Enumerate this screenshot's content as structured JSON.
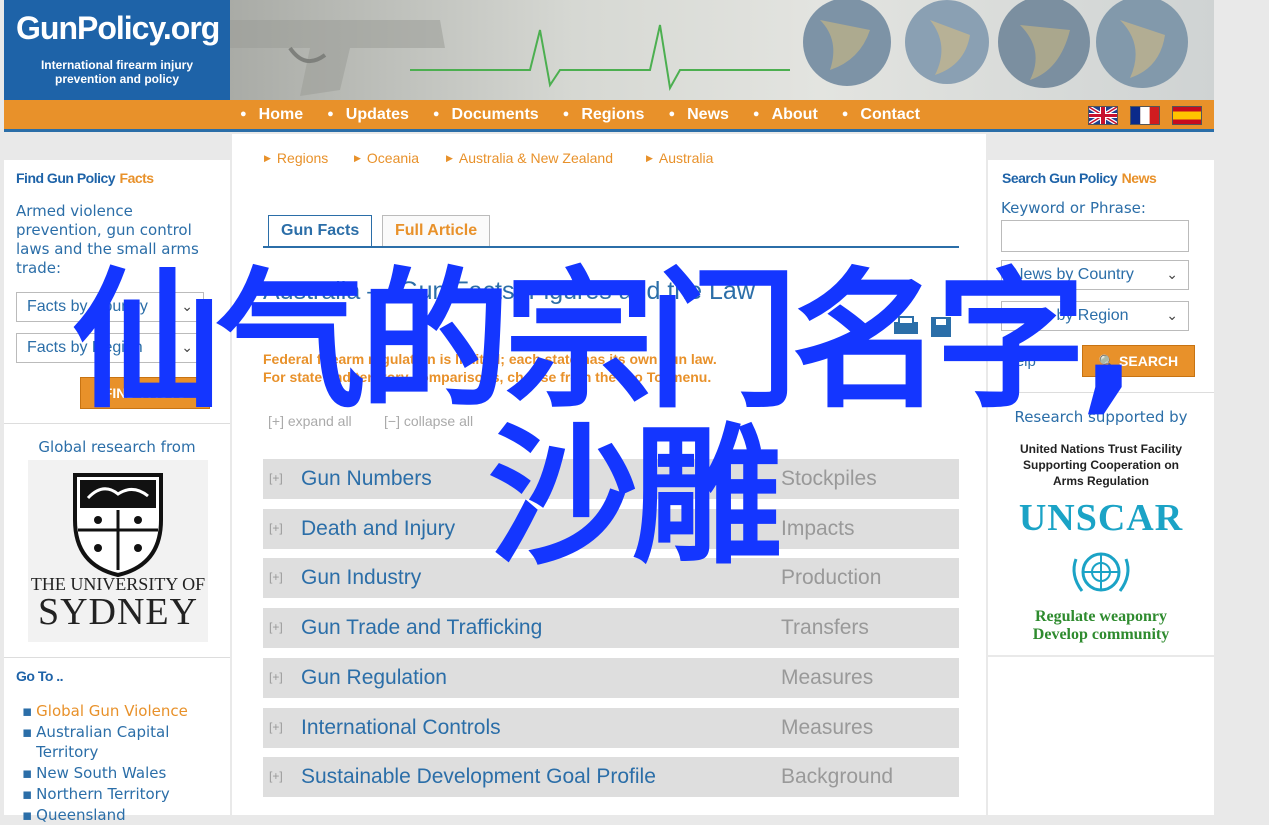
{
  "header": {
    "logo_title": "GunPolicy.org",
    "logo_subtitle_1": "International firearm injury",
    "logo_subtitle_2": "prevention and policy"
  },
  "nav": {
    "items": [
      "Home",
      "Updates",
      "Documents",
      "Regions",
      "News",
      "About",
      "Contact"
    ],
    "flags": [
      "uk-flag",
      "france-flag",
      "spain-flag"
    ]
  },
  "left": {
    "heading_a": "Find Gun Policy",
    "heading_b": "Facts",
    "description": "Armed violence prevention, gun control laws and the small arms trade:",
    "select_country": "Facts by Country",
    "select_region": "Facts by Region",
    "find_button": "FIND FACTS",
    "research_from": "Global research from",
    "university_1": "THE UNIVERSITY OF",
    "university_2": "SYDNEY",
    "goto_heading": "Go To ..",
    "goto_links": [
      "Global Gun Violence",
      "Australian Capital Territory",
      "New South Wales",
      "Northern Territory",
      "Queensland"
    ]
  },
  "center": {
    "breadcrumbs": [
      "Regions",
      "Oceania",
      "Australia & New Zealand",
      "Australia"
    ],
    "tab_gun_facts": "Gun Facts",
    "tab_full_article": "Full Article",
    "page_title": "Australia — Gun Facts, Figures and the Law",
    "notice_line1": "Federal firearm regulation is limited; each state has its own gun law.",
    "notice_line2": "For state and territory comparisons, choose from the 'Go To' menu.",
    "expand_all": "[+] expand all",
    "collapse_all": "[−] collapse all",
    "rows": [
      {
        "label": "Gun Numbers",
        "cat": "Stockpiles"
      },
      {
        "label": "Death and Injury",
        "cat": "Impacts"
      },
      {
        "label": "Gun Industry",
        "cat": "Production"
      },
      {
        "label": "Gun Trade and Trafficking",
        "cat": "Transfers"
      },
      {
        "label": "Gun Regulation",
        "cat": "Measures"
      },
      {
        "label": "International Controls",
        "cat": "Measures"
      },
      {
        "label": "Sustainable Development Goal Profile",
        "cat": "Background"
      }
    ]
  },
  "right": {
    "heading_a": "Search Gun Policy",
    "heading_b": "News",
    "keyword_label": "Keyword or Phrase:",
    "keyword_value": "",
    "select_country": "News by Country",
    "select_region": "News by Region",
    "help": "Help",
    "search_button": "SEARCH",
    "supported_by": "Research supported by",
    "un_line1": "United Nations Trust Facility",
    "un_line2": "Supporting Cooperation on",
    "un_line3": "Arms Regulation",
    "unscar": "UNSCAR",
    "slogan1": "Regulate weaponry",
    "slogan2": "Develop community"
  },
  "overlay": {
    "line1": "仙气的宗门名字,",
    "line2": "沙雕"
  },
  "colors": {
    "brand_blue": "#1e63a8",
    "orange": "#e8912a",
    "overlay_blue": "#1436ff",
    "unscar_teal": "#1ba3c6",
    "slogan_green": "#2e8b2e"
  }
}
